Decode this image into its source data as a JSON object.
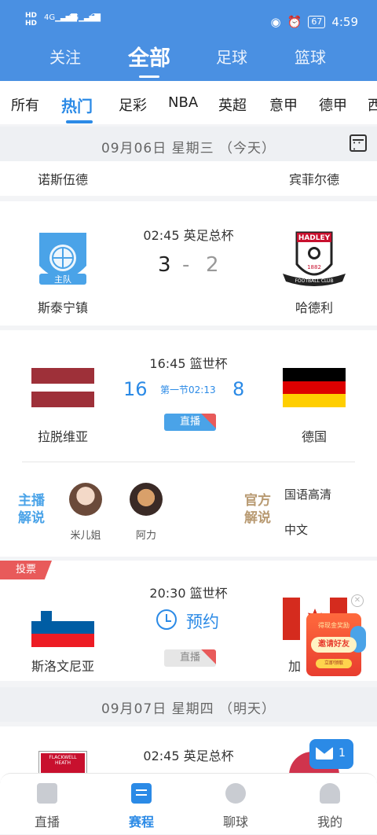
{
  "status": {
    "left_top": "HD",
    "left_bottom": "HD",
    "sig1": "4G",
    "sig2": "4G",
    "battery": "67",
    "time": "4:59"
  },
  "main_tabs": [
    "关注",
    "全部",
    "足球",
    "篮球"
  ],
  "categories": [
    "所有",
    "热门",
    "足彩",
    "NBA",
    "英超",
    "意甲",
    "德甲",
    "西"
  ],
  "dates": {
    "today": "09月06日 星期三 （今天）",
    "tomorrow": "09月07日 星期四 （明天）"
  },
  "partial_match": {
    "home": "诺斯伍德",
    "away": "宾菲尔德"
  },
  "match1": {
    "time_league": "02:45 英足总杯",
    "home": "斯泰宁镇",
    "away": "哈德利",
    "home_score": "3",
    "away_score": "2",
    "separator": "-",
    "home_badge_text": "主队",
    "away_badge_top": "HADLEY",
    "away_badge_year": "1882",
    "away_badge_bottom": "FOOTBALL CLUB"
  },
  "match2": {
    "time_league": "16:45 篮世杯",
    "home": "拉脱维亚",
    "away": "德国",
    "home_score": "16",
    "away_score": "8",
    "period": "第一节02:13",
    "live_label": "直播",
    "anchor_label_left": "主播\n解说",
    "anchor_label_right": "官方\n解说",
    "anchor1": "米儿姐",
    "anchor2": "阿力",
    "lang1": "国语高清",
    "lang2": "中文"
  },
  "match3": {
    "vote_tag": "投票",
    "time_league": "20:30 篮世杯",
    "home": "斯洛文尼亚",
    "away": "加",
    "reserve_label": "预约",
    "live_label": "直播"
  },
  "promo": {
    "line1": "得现金奖励",
    "line2": "邀请好友",
    "line3": "立即领取"
  },
  "match4": {
    "time_league": "02:45 英足总杯",
    "home_badge_text": "FLACKWELL HEATH"
  },
  "mail_count": "1",
  "bottom_nav": [
    "直播",
    "赛程",
    "聊球",
    "我的"
  ],
  "colors": {
    "primary": "#4a90e2",
    "accent": "#2b8ae6",
    "live": "#e85a5a"
  }
}
